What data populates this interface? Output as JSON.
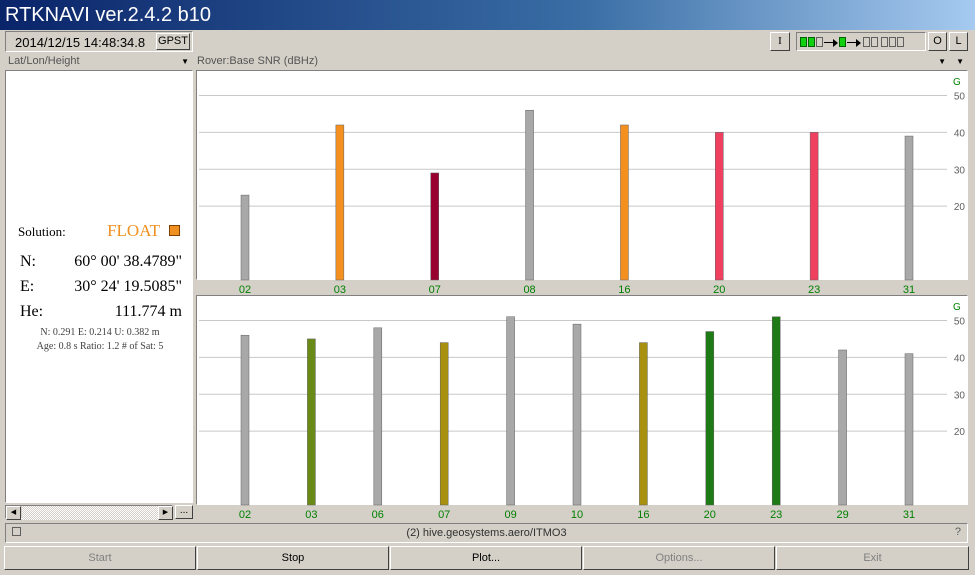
{
  "window": {
    "title": "RTKNAVI ver.2.4.2 b10"
  },
  "toolbar": {
    "clock": "2014/12/15 14:48:34.8",
    "time_system": "GPST",
    "info_label": "I",
    "output_label": "O",
    "log_label": "L",
    "stream_indicators": [
      "on",
      "on",
      "off",
      "arrow",
      "on",
      "arrow",
      "off",
      "off",
      "off",
      "off",
      "off"
    ]
  },
  "left_panel": {
    "selector": "Lat/Lon/Height",
    "solution_label": "Solution:",
    "solution_status": "FLOAT",
    "solution_color": "#f09020",
    "n_label": "N:",
    "n_value": "60° 00' 38.4789\"",
    "e_label": "E:",
    "e_value": "30° 24' 19.5085\"",
    "h_label": "He:",
    "h_value": "111.774 m",
    "std_line": "N: 0.291 E: 0.214 U: 0.382 m",
    "age_line": "Age: 0.8 s Ratio: 1.2 # of Sat: 5",
    "scroll_more": "..."
  },
  "right_panel": {
    "selector": "Rover:Base SNR (dBHz)"
  },
  "chart_data": [
    {
      "type": "bar",
      "title": "",
      "system_label": "G",
      "ylabel": "",
      "ylim": [
        0,
        55
      ],
      "yticks": [
        20,
        30,
        40,
        50
      ],
      "grid": true,
      "categories": [
        "02",
        "03",
        "07",
        "08",
        "16",
        "20",
        "23",
        "31"
      ],
      "values": [
        23,
        42,
        29,
        46,
        42,
        40,
        40,
        39
      ],
      "colors": [
        "#a8a8a8",
        "#f49020",
        "#980030",
        "#a8a8a8",
        "#f49020",
        "#f04060",
        "#f04060",
        "#a8a8a8"
      ]
    },
    {
      "type": "bar",
      "title": "",
      "system_label": "G",
      "ylabel": "",
      "ylim": [
        0,
        55
      ],
      "yticks": [
        20,
        30,
        40,
        50
      ],
      "grid": true,
      "categories": [
        "02",
        "03",
        "06",
        "07",
        "09",
        "10",
        "16",
        "20",
        "23",
        "29",
        "31"
      ],
      "values": [
        46,
        45,
        48,
        44,
        51,
        49,
        44,
        47,
        51,
        42,
        41
      ],
      "colors": [
        "#a8a8a8",
        "#6a8a18",
        "#a8a8a8",
        "#a89010",
        "#a8a8a8",
        "#a8a8a8",
        "#a89010",
        "#1e7a14",
        "#1e7a14",
        "#a8a8a8",
        "#a8a8a8"
      ]
    }
  ],
  "status_bar": {
    "text": "(2) hive.geosystems.aero/ITMO3",
    "help": "?"
  },
  "buttons": {
    "start": "Start",
    "stop": "Stop",
    "plot": "Plot...",
    "options": "Options...",
    "exit": "Exit"
  }
}
